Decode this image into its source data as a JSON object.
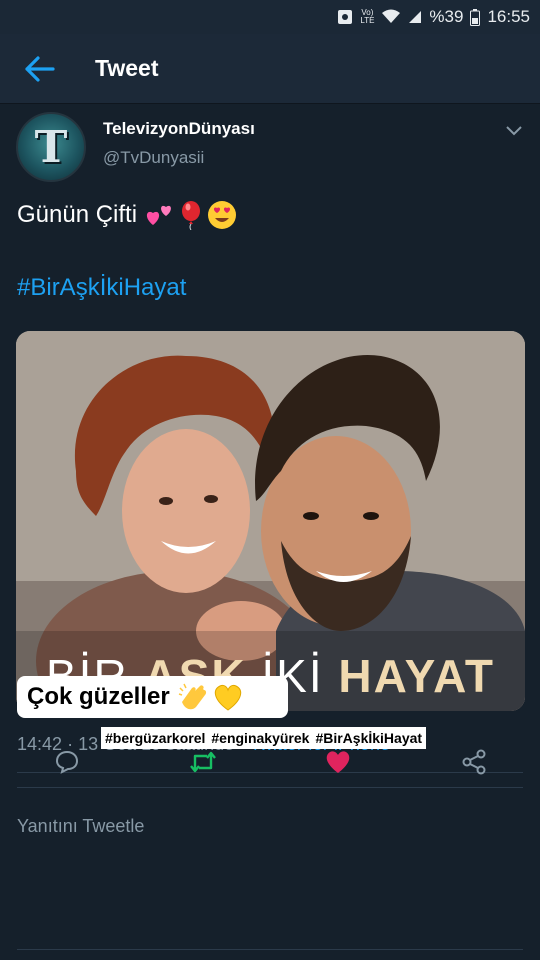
{
  "status_bar": {
    "volte_top": "Vo)",
    "volte_bottom": "LTE",
    "battery": "%39",
    "time": "16:55"
  },
  "header": {
    "title": "Tweet",
    "back_icon": "arrow-left-icon"
  },
  "tweet": {
    "author_name": "TelevizyonDünyası",
    "author_handle": "@TvDunyasii",
    "avatar_letter": "T",
    "text": "Günün Çifti",
    "emojis": [
      "two-hearts",
      "balloon",
      "heart-eyes"
    ],
    "hashtag": "#BirAşkİkiHayat",
    "media": {
      "poster_word_1": "BİR",
      "poster_word_2": "AŞK",
      "poster_word_3": "İKİ",
      "poster_word_4": "HAYAT"
    },
    "time": "14:42",
    "date_text": "13 Oca 19 saatinde",
    "separator": "·",
    "source": "Twitter for iPhone"
  },
  "overlay": {
    "sticker_text": "Çok güzeller",
    "sticker_emojis": [
      "clapping-hands",
      "yellow-heart"
    ],
    "tags": [
      "#bergüzarkorel",
      "#enginakyürek",
      "#BirAşkİkiHayat"
    ]
  },
  "actions": {
    "reply_icon": "reply-icon",
    "retweet_icon": "retweet-icon",
    "like_icon": "heart-icon",
    "share_icon": "share-icon",
    "like_color": "#e0245e",
    "retweet_color": "#17bf63"
  },
  "reply": {
    "placeholder": "Yanıtını Tweetle"
  },
  "colors": {
    "background": "#15202b",
    "accent": "#1da1f2",
    "secondary_text": "#8899a6"
  }
}
